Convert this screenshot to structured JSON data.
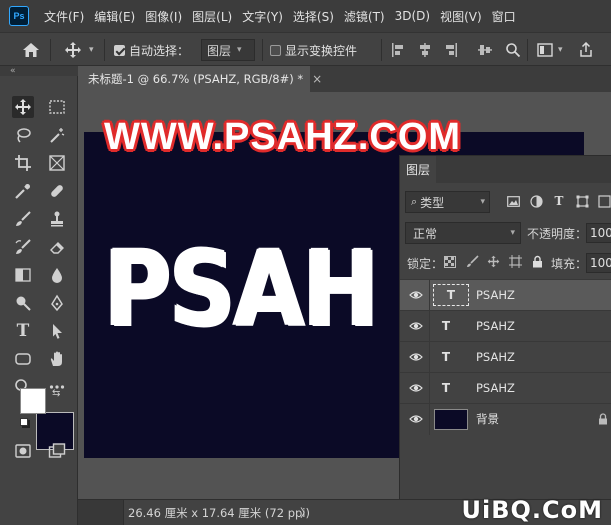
{
  "app": {
    "logo_text": "Ps",
    "menu": [
      "文件(F)",
      "编辑(E)",
      "图像(I)",
      "图层(L)",
      "文字(Y)",
      "选择(S)",
      "滤镜(T)",
      "3D(D)",
      "视图(V)",
      "窗口"
    ]
  },
  "options_bar": {
    "auto_select_label": "自动选择：",
    "auto_select_checked": true,
    "auto_select_target": "图层",
    "show_transform_label": "显示变换控件",
    "show_transform_checked": false
  },
  "document": {
    "tab_title": "未标题-1 @ 66.7% (PSAHZ, RGB/8#) *",
    "close_glyph": "×",
    "collapse_glyph": "«",
    "canvas_text": "PSAH",
    "canvas_bg_color": "#0b0a26",
    "status_info": "26.46 厘米 x 17.64 厘米 (72 ppi)",
    "status_arrow": "〉"
  },
  "watermarks": {
    "top": "WWW.PSAHZ.COM",
    "bottom": "UiBQ.CoM"
  },
  "layers_panel": {
    "tab_label": "图层",
    "filter_kind": "类型",
    "blend_mode": "正常",
    "opacity_label": "不透明度：",
    "opacity_value": "100%",
    "lock_label": "锁定：",
    "fill_label": "填充：",
    "fill_value": "100%",
    "text_thumb_glyph": "T",
    "layers": [
      {
        "name": "PSAHZ",
        "type": "text",
        "selected": true
      },
      {
        "name": "PSAHZ",
        "type": "text",
        "selected": false
      },
      {
        "name": "PSAHZ",
        "type": "text",
        "selected": false
      },
      {
        "name": "PSAHZ",
        "type": "text",
        "selected": false
      },
      {
        "name": "背景",
        "type": "background",
        "selected": false
      }
    ]
  },
  "tools": [
    "move-tool",
    "marquee-tool",
    "lasso-tool",
    "magic-wand-tool",
    "crop-tool",
    "frame-tool",
    "eyedropper-tool",
    "healing-brush-tool",
    "brush-tool",
    "stamp-tool",
    "history-brush-tool",
    "eraser-tool",
    "gradient-tool",
    "blur-tool",
    "dodge-tool",
    "pen-tool",
    "type-tool",
    "path-selection-tool",
    "shape-tool",
    "hand-tool",
    "zoom-tool",
    "more-tools"
  ],
  "colors": {
    "foreground": "#ffffff",
    "background": "#0b0a26",
    "watermark_outline": "#e02b2b"
  }
}
